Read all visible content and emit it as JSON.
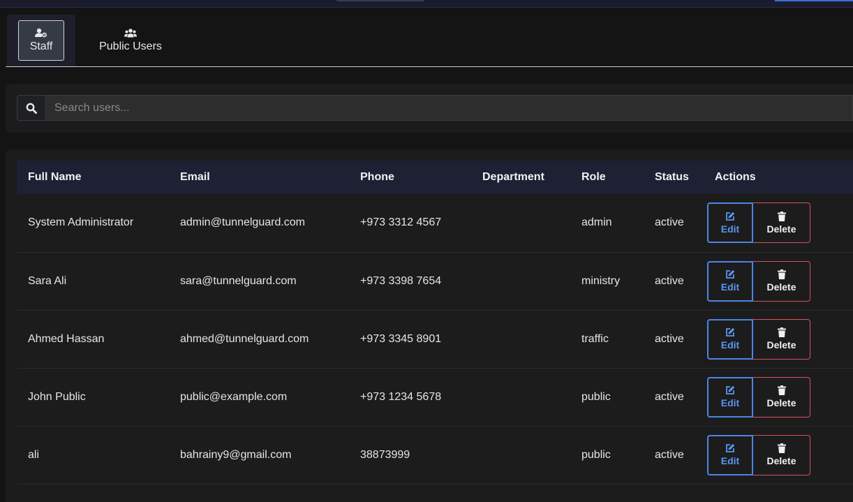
{
  "tabs": [
    {
      "label": "Staff",
      "icon": "user-gear-icon",
      "active": true
    },
    {
      "label": "Public Users",
      "icon": "users-icon",
      "active": false
    }
  ],
  "search": {
    "placeholder": "Search users...",
    "value": ""
  },
  "table": {
    "columns": [
      "Full Name",
      "Email",
      "Phone",
      "Department",
      "Role",
      "Status",
      "Actions"
    ],
    "rows": [
      {
        "name": "System Administrator",
        "email": "admin@tunnelguard.com",
        "phone": "+973 3312 4567",
        "department": "",
        "role": "admin",
        "status": "active"
      },
      {
        "name": "Sara Ali",
        "email": "sara@tunnelguard.com",
        "phone": "+973 3398 7654",
        "department": "",
        "role": "ministry",
        "status": "active"
      },
      {
        "name": "Ahmed Hassan",
        "email": "ahmed@tunnelguard.com",
        "phone": "+973 3345 8901",
        "department": "",
        "role": "traffic",
        "status": "active"
      },
      {
        "name": "John Public",
        "email": "public@example.com",
        "phone": "+973 1234 5678",
        "department": "",
        "role": "public",
        "status": "active"
      },
      {
        "name": "ali",
        "email": "bahrainy9@gmail.com",
        "phone": "38873999",
        "department": "",
        "role": "public",
        "status": "active"
      }
    ],
    "edit_label": "Edit",
    "delete_label": "Delete"
  },
  "colors": {
    "accent": "#4a86e8",
    "danger": "#d9535f",
    "header_bg": "#1e2033"
  }
}
